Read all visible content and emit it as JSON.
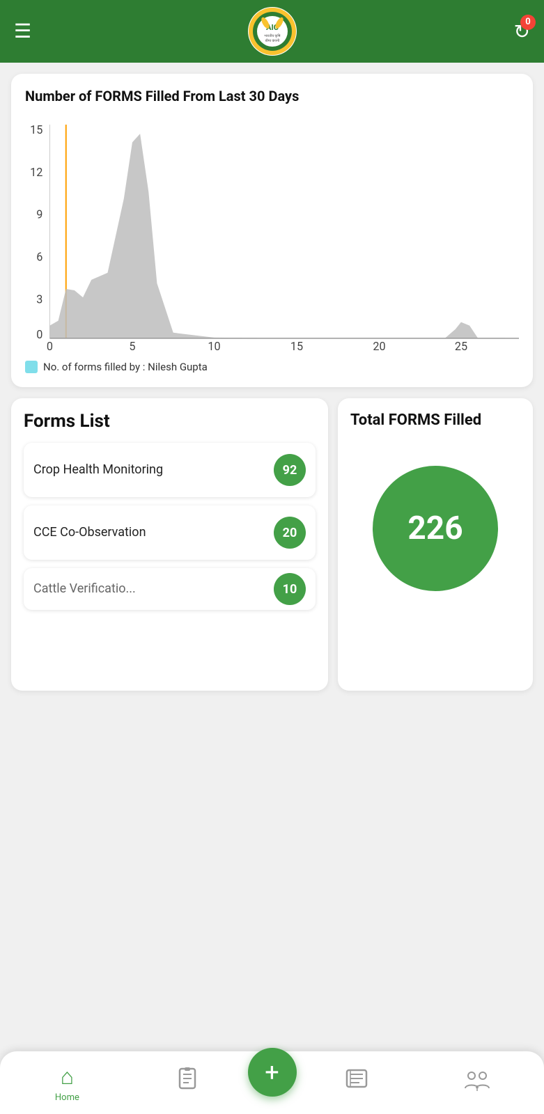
{
  "header": {
    "menu_icon": "☰",
    "logo_text": "AIC",
    "logo_subtitle": "भारतीय कृषि बीमा कंपनी",
    "badge_count": "0",
    "refresh_icon": "↻"
  },
  "chart": {
    "title": "Number of FORMS Filled From Last 30 Days",
    "legend_label": "No. of forms filled by : Nilesh Gupta",
    "y_axis": [
      15,
      12,
      9,
      6,
      3,
      0
    ],
    "x_axis": [
      0,
      5,
      10,
      15,
      20,
      25
    ]
  },
  "forms_list": {
    "title": "Forms List",
    "items": [
      {
        "name": "Crop Health Monitoring",
        "count": "92"
      },
      {
        "name": "CCE Co-Observation",
        "count": "20"
      },
      {
        "name": "Cattle Verification",
        "count": "10"
      }
    ]
  },
  "total_forms": {
    "title": "Total FORMS Filled",
    "count": "226"
  },
  "nav": {
    "home_label": "Home",
    "fab_label": "+",
    "items": [
      {
        "name": "home",
        "label": "Home",
        "active": true
      },
      {
        "name": "forms",
        "label": "",
        "active": false
      },
      {
        "name": "add",
        "label": "",
        "active": false
      },
      {
        "name": "list",
        "label": "",
        "active": false
      },
      {
        "name": "team",
        "label": "",
        "active": false
      }
    ]
  }
}
